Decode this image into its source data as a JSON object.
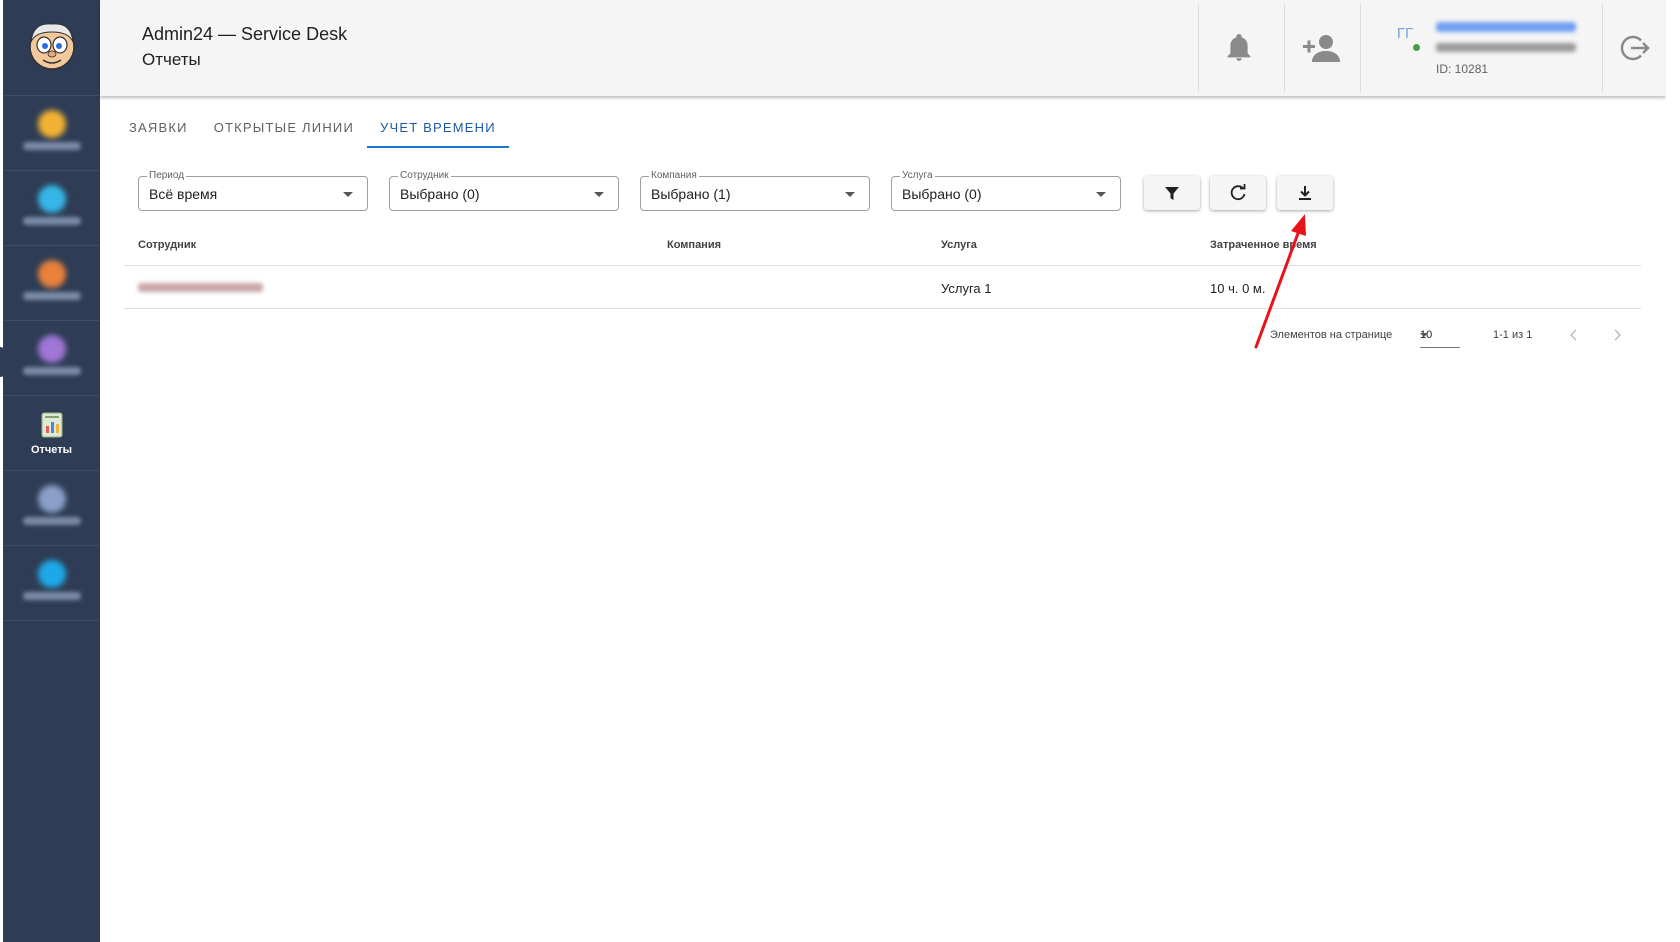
{
  "header": {
    "app_title": "Admin24 — Service Desk",
    "page_subtitle": "Отчеты",
    "user": {
      "initials": "ГГ",
      "id_text": "ID: 10281"
    }
  },
  "sidebar": {
    "items": [
      {
        "label": "",
        "icon": "blurred-icon",
        "color": "#f2b233"
      },
      {
        "label": "",
        "icon": "blurred-icon",
        "color": "#36b6e8"
      },
      {
        "label": "",
        "icon": "blurred-icon",
        "color": "#e9813d"
      },
      {
        "label": "",
        "icon": "blurred-icon",
        "color": "#a076d6"
      },
      {
        "label": "Отчеты",
        "icon": "report-document-icon",
        "active": true
      },
      {
        "label": "",
        "icon": "blurred-icon",
        "color": "#8aa0c8"
      },
      {
        "label": "",
        "icon": "blurred-icon",
        "color": "#1ea8e8"
      }
    ]
  },
  "tabs": [
    {
      "label": "ЗАЯВКИ",
      "active": false
    },
    {
      "label": "ОТКРЫТЫЕ ЛИНИИ",
      "active": false
    },
    {
      "label": "УЧЕТ ВРЕМЕНИ",
      "active": true
    }
  ],
  "filters": {
    "period": {
      "label": "Период",
      "value": "Всё время"
    },
    "employee": {
      "label": "Сотрудник",
      "value": "Выбрано (0)"
    },
    "company": {
      "label": "Компания",
      "value": "Выбрано (1)"
    },
    "service": {
      "label": "Услуга",
      "value": "Выбрано (0)"
    }
  },
  "table": {
    "columns": [
      "Сотрудник",
      "Компания",
      "Услуга",
      "Затраченное время"
    ],
    "rows": [
      {
        "employee": "",
        "company": "",
        "service": "Услуга 1",
        "time": "10 ч. 0 м."
      }
    ]
  },
  "pagination": {
    "per_page_label": "Элементов на странице",
    "per_page_value": "10",
    "range_text": "1-1 из 1"
  },
  "colors": {
    "sidebar_bg": "#2e3d55",
    "accent": "#1976d2",
    "annotation_arrow": "#e8141b"
  }
}
